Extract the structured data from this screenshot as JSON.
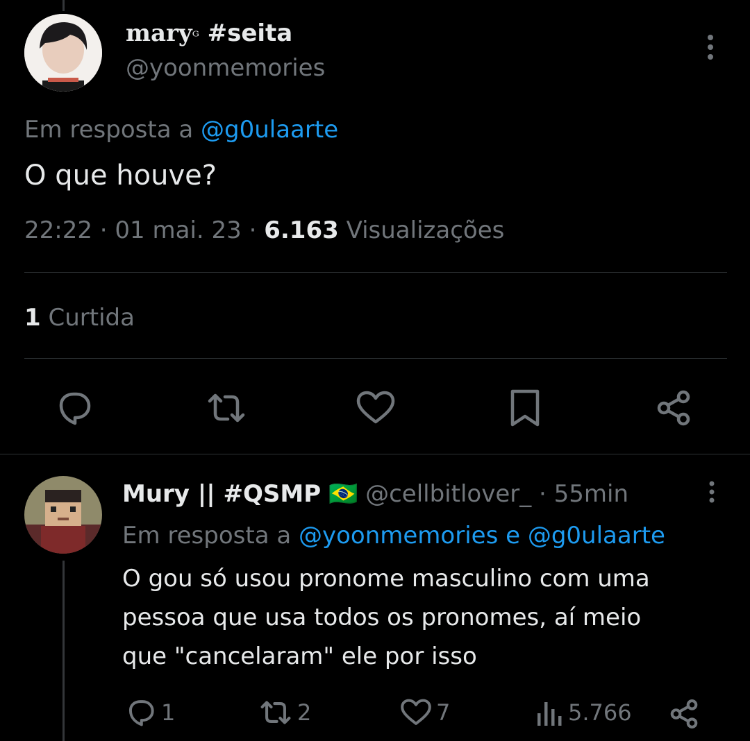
{
  "main_tweet": {
    "display_name": "mary",
    "name_glyph": "ᴳ",
    "name_suffix": "#seita",
    "handle": "@yoonmemories",
    "reply_prefix": "Em resposta a",
    "reply_to": "@g0ulaarte",
    "text": "O que houve?",
    "time": "22:22",
    "date": "01 mai. 23",
    "views_count": "6.163",
    "views_label": "Visualizações",
    "likes_count": "1",
    "likes_label": "Curtida"
  },
  "reply_tweet": {
    "display_name": "Mury || #QSMP",
    "flag": "🇧🇷",
    "handle": "@cellbitlover_",
    "time": "55min",
    "reply_prefix": "Em resposta a",
    "reply_to_1": "@yoonmemories",
    "reply_joiner": "e",
    "reply_to_2": "@g0ulaarte",
    "text_lines": [
      "O gou só usou pronome masculino com uma",
      "pessoa que usa todos os pronomes, aí meio",
      "que \"cancelaram\" ele por isso"
    ],
    "metrics": {
      "replies": "1",
      "retweets": "2",
      "likes": "7",
      "views": "5.766"
    }
  },
  "colors": {
    "background": "#000000",
    "text": "#e7e9ea",
    "secondary": "#71767b",
    "link": "#1d9bf0",
    "divider": "#2f3336"
  },
  "icons": [
    "more-icon",
    "reply-icon",
    "retweet-icon",
    "like-icon",
    "bookmark-icon",
    "share-icon",
    "views-icon"
  ]
}
